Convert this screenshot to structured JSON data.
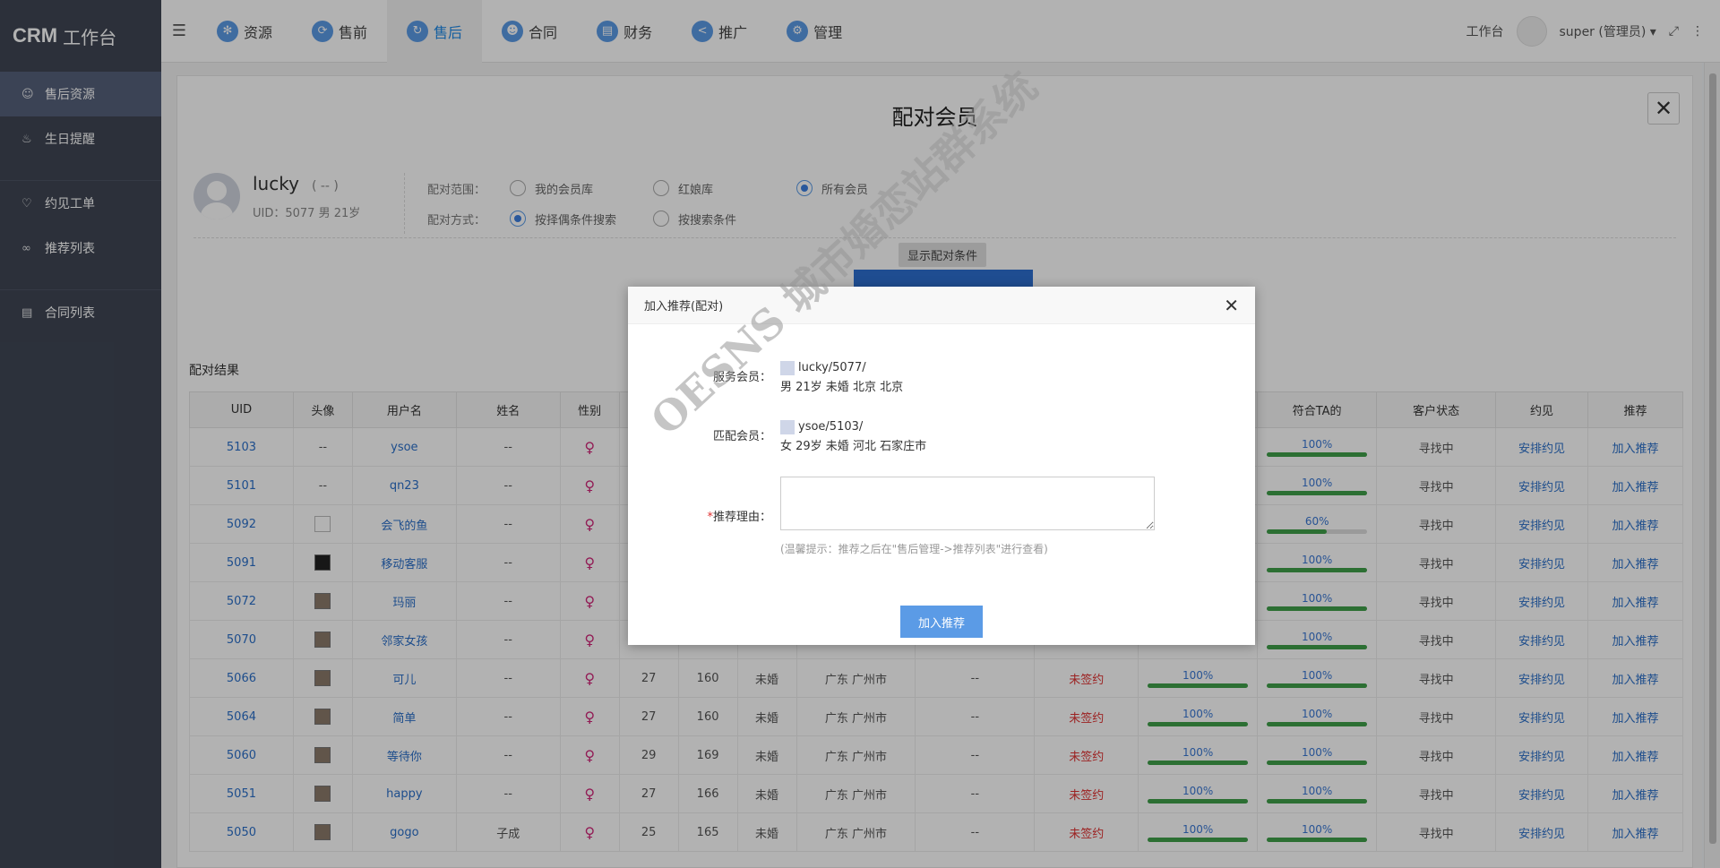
{
  "app": {
    "logo_bold": "CRM",
    "logo_text": "工作台"
  },
  "sidebar": {
    "items": [
      {
        "label": "售后资源",
        "icon": "user-icon",
        "active": true
      },
      {
        "label": "生日提醒",
        "icon": "cake-icon"
      },
      {
        "label": "约见工单",
        "icon": "heart-icon"
      },
      {
        "label": "推荐列表",
        "icon": "link-icon"
      },
      {
        "label": "合同列表",
        "icon": "document-icon"
      }
    ]
  },
  "topnav": {
    "items": [
      {
        "label": "资源",
        "icon": "resource-icon"
      },
      {
        "label": "售前",
        "icon": "presale-icon"
      },
      {
        "label": "售后",
        "icon": "aftersale-icon",
        "active": true
      },
      {
        "label": "合同",
        "icon": "contract-icon"
      },
      {
        "label": "财务",
        "icon": "finance-icon"
      },
      {
        "label": "推广",
        "icon": "share-icon"
      },
      {
        "label": "管理",
        "icon": "settings-icon"
      }
    ],
    "workbench": "工作台",
    "user": "super (管理员)"
  },
  "page": {
    "title": "配对会员",
    "user": {
      "name": "lucky",
      "alias": "( -- )",
      "info": "UID：5077 男 21岁"
    },
    "range_label": "配对范围：",
    "range_options": [
      "我的会员库",
      "红娘库",
      "所有会员"
    ],
    "method_label": "配对方式：",
    "method_options": [
      "按择偶条件搜索",
      "按搜索条件"
    ],
    "show_conditions": "显示配对条件",
    "result_title": "配对结果"
  },
  "table": {
    "headers_left": [
      "UID",
      "头像",
      "用户名",
      "姓名",
      "性别"
    ],
    "headers_right": [
      "符合TA的",
      "客户状态",
      "约见",
      "推荐"
    ],
    "rows": [
      {
        "uid": "5103",
        "avatar": "--",
        "username": "ysoe",
        "name": "--",
        "age": "",
        "height": "",
        "marital": "",
        "city": "",
        "extra": "",
        "sign": "",
        "match1": "",
        "match2": "100%",
        "m2": 1.0,
        "status": "寻找中",
        "meet": "安排约见",
        "rec": "加入推荐"
      },
      {
        "uid": "5101",
        "avatar": "--",
        "username": "qn23",
        "name": "--",
        "age": "",
        "height": "",
        "marital": "",
        "city": "",
        "extra": "",
        "sign": "",
        "match1": "",
        "match2": "100%",
        "m2": 1.0,
        "status": "寻找中",
        "meet": "安排约见",
        "rec": "加入推荐"
      },
      {
        "uid": "5092",
        "avatar": "img-broken",
        "username": "会飞的鱼",
        "name": "--",
        "age": "",
        "height": "",
        "marital": "",
        "city": "",
        "extra": "",
        "sign": "",
        "match1": "",
        "match2": "60%",
        "m2": 0.6,
        "status": "寻找中",
        "meet": "安排约见",
        "rec": "加入推荐"
      },
      {
        "uid": "5091",
        "avatar": "img-bag",
        "username": "移动客服",
        "name": "--",
        "age": "",
        "height": "",
        "marital": "",
        "city": "",
        "extra": "",
        "sign": "",
        "match1": "",
        "match2": "100%",
        "m2": 1.0,
        "status": "寻找中",
        "meet": "安排约见",
        "rec": "加入推荐"
      },
      {
        "uid": "5072",
        "avatar": "img",
        "username": "玛丽",
        "name": "--",
        "age": "",
        "height": "",
        "marital": "",
        "city": "",
        "extra": "",
        "sign": "",
        "match1": "",
        "match2": "100%",
        "m2": 1.0,
        "status": "寻找中",
        "meet": "安排约见",
        "rec": "加入推荐"
      },
      {
        "uid": "5070",
        "avatar": "img",
        "username": "邻家女孩",
        "name": "--",
        "age": "",
        "height": "",
        "marital": "",
        "city": "",
        "extra": "",
        "sign": "",
        "match1": "",
        "m1": 1.0,
        "match2": "100%",
        "m2": 1.0,
        "status": "寻找中",
        "meet": "安排约见",
        "rec": "加入推荐"
      },
      {
        "uid": "5066",
        "avatar": "img",
        "username": "可儿",
        "name": "--",
        "age": "27",
        "height": "160",
        "marital": "未婚",
        "city": "广东 广州市",
        "extra": "--",
        "sign": "未签约",
        "match1": "100%",
        "m1": 1.0,
        "match2": "100%",
        "m2": 1.0,
        "status": "寻找中",
        "meet": "安排约见",
        "rec": "加入推荐"
      },
      {
        "uid": "5064",
        "avatar": "img",
        "username": "简单",
        "name": "--",
        "age": "27",
        "height": "160",
        "marital": "未婚",
        "city": "广东 广州市",
        "extra": "--",
        "sign": "未签约",
        "match1": "100%",
        "m1": 1.0,
        "match2": "100%",
        "m2": 1.0,
        "status": "寻找中",
        "meet": "安排约见",
        "rec": "加入推荐"
      },
      {
        "uid": "5060",
        "avatar": "img",
        "username": "等待你",
        "name": "--",
        "age": "29",
        "height": "169",
        "marital": "未婚",
        "city": "广东 广州市",
        "extra": "--",
        "sign": "未签约",
        "match1": "100%",
        "m1": 1.0,
        "match2": "100%",
        "m2": 1.0,
        "status": "寻找中",
        "meet": "安排约见",
        "rec": "加入推荐"
      },
      {
        "uid": "5051",
        "avatar": "img",
        "username": "happy",
        "name": "--",
        "age": "27",
        "height": "166",
        "marital": "未婚",
        "city": "广东 广州市",
        "extra": "--",
        "sign": "未签约",
        "match1": "100%",
        "m1": 1.0,
        "match2": "100%",
        "m2": 1.0,
        "status": "寻找中",
        "meet": "安排约见",
        "rec": "加入推荐"
      },
      {
        "uid": "5050",
        "avatar": "img",
        "username": "gogo",
        "name": "子成",
        "age": "25",
        "height": "165",
        "marital": "未婚",
        "city": "广东 广州市",
        "extra": "--",
        "sign": "未签约",
        "match1": "100%",
        "m1": 1.0,
        "match2": "100%",
        "m2": 1.0,
        "status": "寻找中",
        "meet": "安排约见",
        "rec": "加入推荐"
      }
    ]
  },
  "dialog": {
    "title": "加入推荐(配对)",
    "service_label": "服务会员：",
    "service_line1": "lucky/5077/",
    "service_line2": "男 21岁 未婚 北京 北京",
    "match_label": "匹配会员：",
    "match_line1": "ysoe/5103/",
    "match_line2": "女 29岁 未婚 河北 石家庄市",
    "reason_label": "推荐理由：",
    "required_mark": "*",
    "hint": "(温馨提示：推荐之后在\"售后管理->推荐列表\"进行查看)",
    "submit": "加入推荐"
  },
  "watermark": "OESNS 城市婚恋站群系统"
}
